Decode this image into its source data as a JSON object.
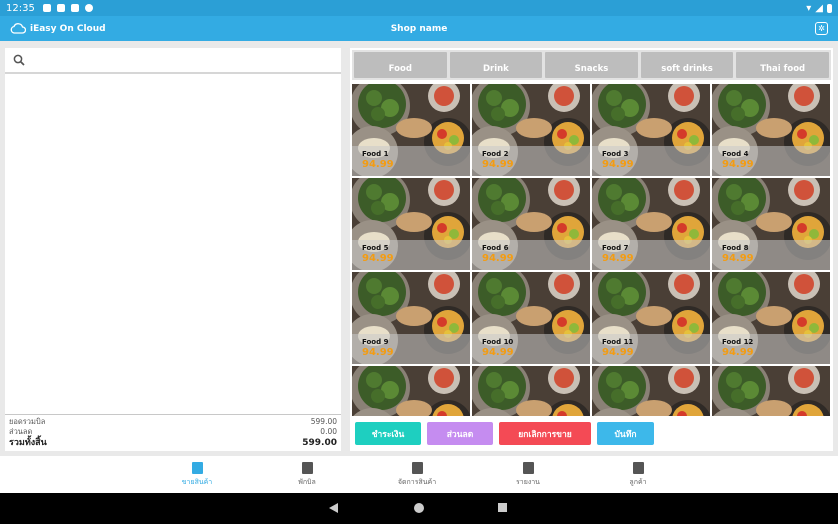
{
  "status": {
    "time": "12:35"
  },
  "app": {
    "brand": "iEasy On Cloud",
    "shop_name": "Shop name"
  },
  "search": {
    "placeholder": "",
    "value": ""
  },
  "totals": {
    "subtotal_label": "ยอดรวมบิล",
    "subtotal_value": "599.00",
    "discount_label": "ส่วนลด",
    "discount_value": "0.00",
    "grand_label": "รวมทั้งสิ้น",
    "grand_value": "599.00"
  },
  "categories": [
    "Food",
    "Drink",
    "Snacks",
    "soft drinks",
    "Thai food"
  ],
  "products": [
    {
      "name": "Food 1",
      "price": "94.99"
    },
    {
      "name": "Food 2",
      "price": "94.99"
    },
    {
      "name": "Food 3",
      "price": "94.99"
    },
    {
      "name": "Food 4",
      "price": "94.99"
    },
    {
      "name": "Food 5",
      "price": "94.99"
    },
    {
      "name": "Food 6",
      "price": "94.99"
    },
    {
      "name": "Food 7",
      "price": "94.99"
    },
    {
      "name": "Food 8",
      "price": "94.99"
    },
    {
      "name": "Food 9",
      "price": "94.99"
    },
    {
      "name": "Food 10",
      "price": "94.99"
    },
    {
      "name": "Food 11",
      "price": "94.99"
    },
    {
      "name": "Food 12",
      "price": "94.99"
    },
    {
      "name": "",
      "price": ""
    },
    {
      "name": "",
      "price": ""
    },
    {
      "name": "",
      "price": ""
    },
    {
      "name": "",
      "price": ""
    }
  ],
  "actions": [
    {
      "label": "ชำระเงิน",
      "color": "#1ecfc0"
    },
    {
      "label": "ส่วนลด",
      "color": "#c58cf0"
    },
    {
      "label": "ยกเลิกการขาย",
      "color": "#f44a55"
    },
    {
      "label": "บันทึก",
      "color": "#3db8ea"
    }
  ],
  "nav": [
    {
      "label": "ขายสินค้า",
      "active": true
    },
    {
      "label": "พักบิล",
      "active": false
    },
    {
      "label": "จัดการสินค้า",
      "active": false
    },
    {
      "label": "รายงาน",
      "active": false
    },
    {
      "label": "ลูกค้า",
      "active": false
    }
  ],
  "colors": {
    "accent": "#33abe3",
    "price": "#f39c12"
  }
}
